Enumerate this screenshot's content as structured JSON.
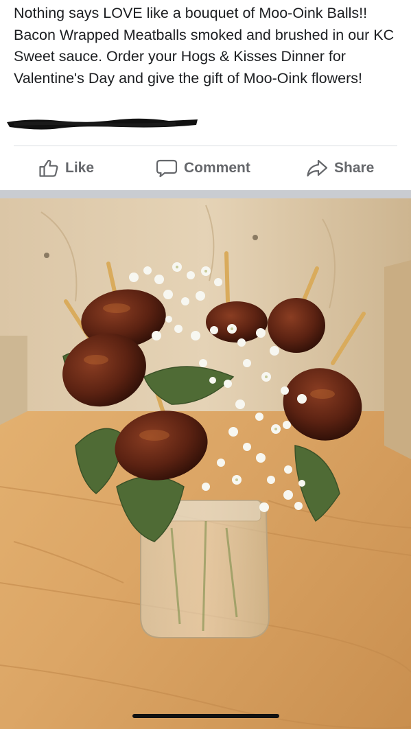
{
  "post": {
    "text": "Nothing says LOVE like a bouquet of Moo-Oink Balls!! Bacon Wrapped Meatballs smoked and brushed in our KC Sweet sauce. Order your Hogs & Kisses Dinner for Valentine's Day and give the gift of Moo-Oink flowers!"
  },
  "actions": {
    "like_label": "Like",
    "comment_label": "Comment",
    "share_label": "Share"
  },
  "icons": {
    "like": "thumbs-up-icon",
    "comment": "speech-bubble-icon",
    "share": "share-arrow-icon"
  },
  "colors": {
    "action_text": "#65676b",
    "post_text": "#1c1e21",
    "divider": "#dadde1",
    "separator_band": "#c9ccd1"
  }
}
